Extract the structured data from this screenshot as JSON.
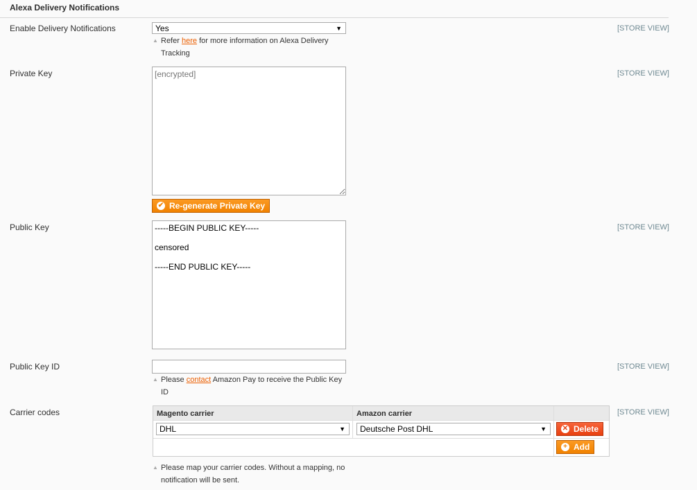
{
  "section_title": "Alexa Delivery Notifications",
  "scope_label": "[STORE VIEW]",
  "enable": {
    "label": "Enable Delivery Notifications",
    "value": "Yes",
    "note_pre": "Refer",
    "note_link": "here",
    "note_post": "for more information on Alexa Delivery",
    "note_line2": "Tracking"
  },
  "private_key": {
    "label": "Private Key",
    "value": "[encrypted]",
    "button": "Re-generate Private Key"
  },
  "public_key": {
    "label": "Public Key",
    "value": "-----BEGIN PUBLIC KEY-----\n\ncensored\n\n-----END PUBLIC KEY-----"
  },
  "public_key_id": {
    "label": "Public Key ID",
    "value": "",
    "note_pre": "Please",
    "note_link": "contact",
    "note_post": "Amazon Pay to receive the Public Key",
    "note_line2": "ID"
  },
  "carrier_codes": {
    "label": "Carrier codes",
    "col_magento": "Magento carrier",
    "col_amazon": "Amazon carrier",
    "rows": [
      {
        "magento": "DHL",
        "amazon": "Deutsche Post DHL"
      }
    ],
    "delete_label": "Delete",
    "add_label": "Add",
    "note_line1": "Please map your carrier codes. Without a mapping, no",
    "note_line2": "notification will be sent."
  },
  "colors": {
    "button": "#f18200",
    "delete": "#e8400f",
    "link": "#eb5e00"
  }
}
